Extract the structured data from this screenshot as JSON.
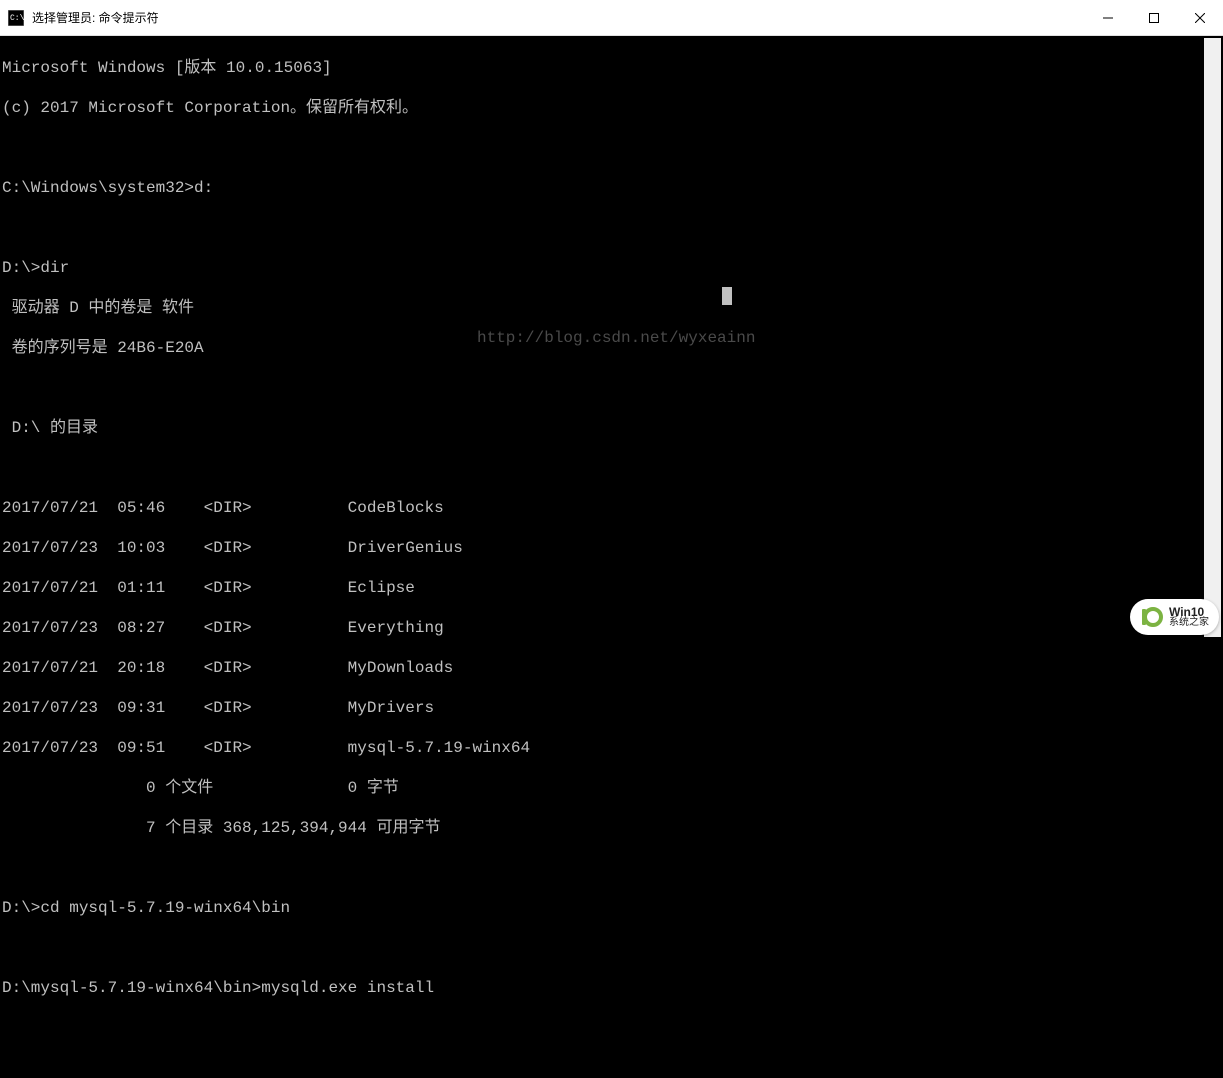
{
  "window": {
    "title": "选择管理员: 命令提示符"
  },
  "terminal": {
    "header1": "Microsoft Windows [版本 10.0.15063]",
    "header2": "(c) 2017 Microsoft Corporation。保留所有权利。",
    "prompt1": "C:\\Windows\\system32>d:",
    "prompt2": "D:\\>dir",
    "vol_line": " 驱动器 D 中的卷是 软件",
    "serial_line": " 卷的序列号是 24B6-E20A",
    "dir_header": " D:\\ 的目录",
    "entries": [
      "2017/07/21  05:46    <DIR>          CodeBlocks",
      "2017/07/23  10:03    <DIR>          DriverGenius",
      "2017/07/21  01:11    <DIR>          Eclipse",
      "2017/07/23  08:27    <DIR>          Everything",
      "2017/07/21  20:18    <DIR>          MyDownloads",
      "2017/07/23  09:31    <DIR>          MyDrivers",
      "2017/07/23  09:51    <DIR>          mysql-5.7.19-winx64"
    ],
    "summary1": "               0 个文件              0 字节",
    "summary2": "               7 个目录 368,125,394,944 可用字节",
    "prompt3": "D:\\>cd mysql-5.7.19-winx64\\bin",
    "prompt4": "D:\\mysql-5.7.19-winx64\\bin>mysqld.exe install"
  },
  "watermark": {
    "url": "http://blog.csdn.net/wyxeainn",
    "badge_top": "Win10",
    "badge_bot": "系统之家"
  }
}
